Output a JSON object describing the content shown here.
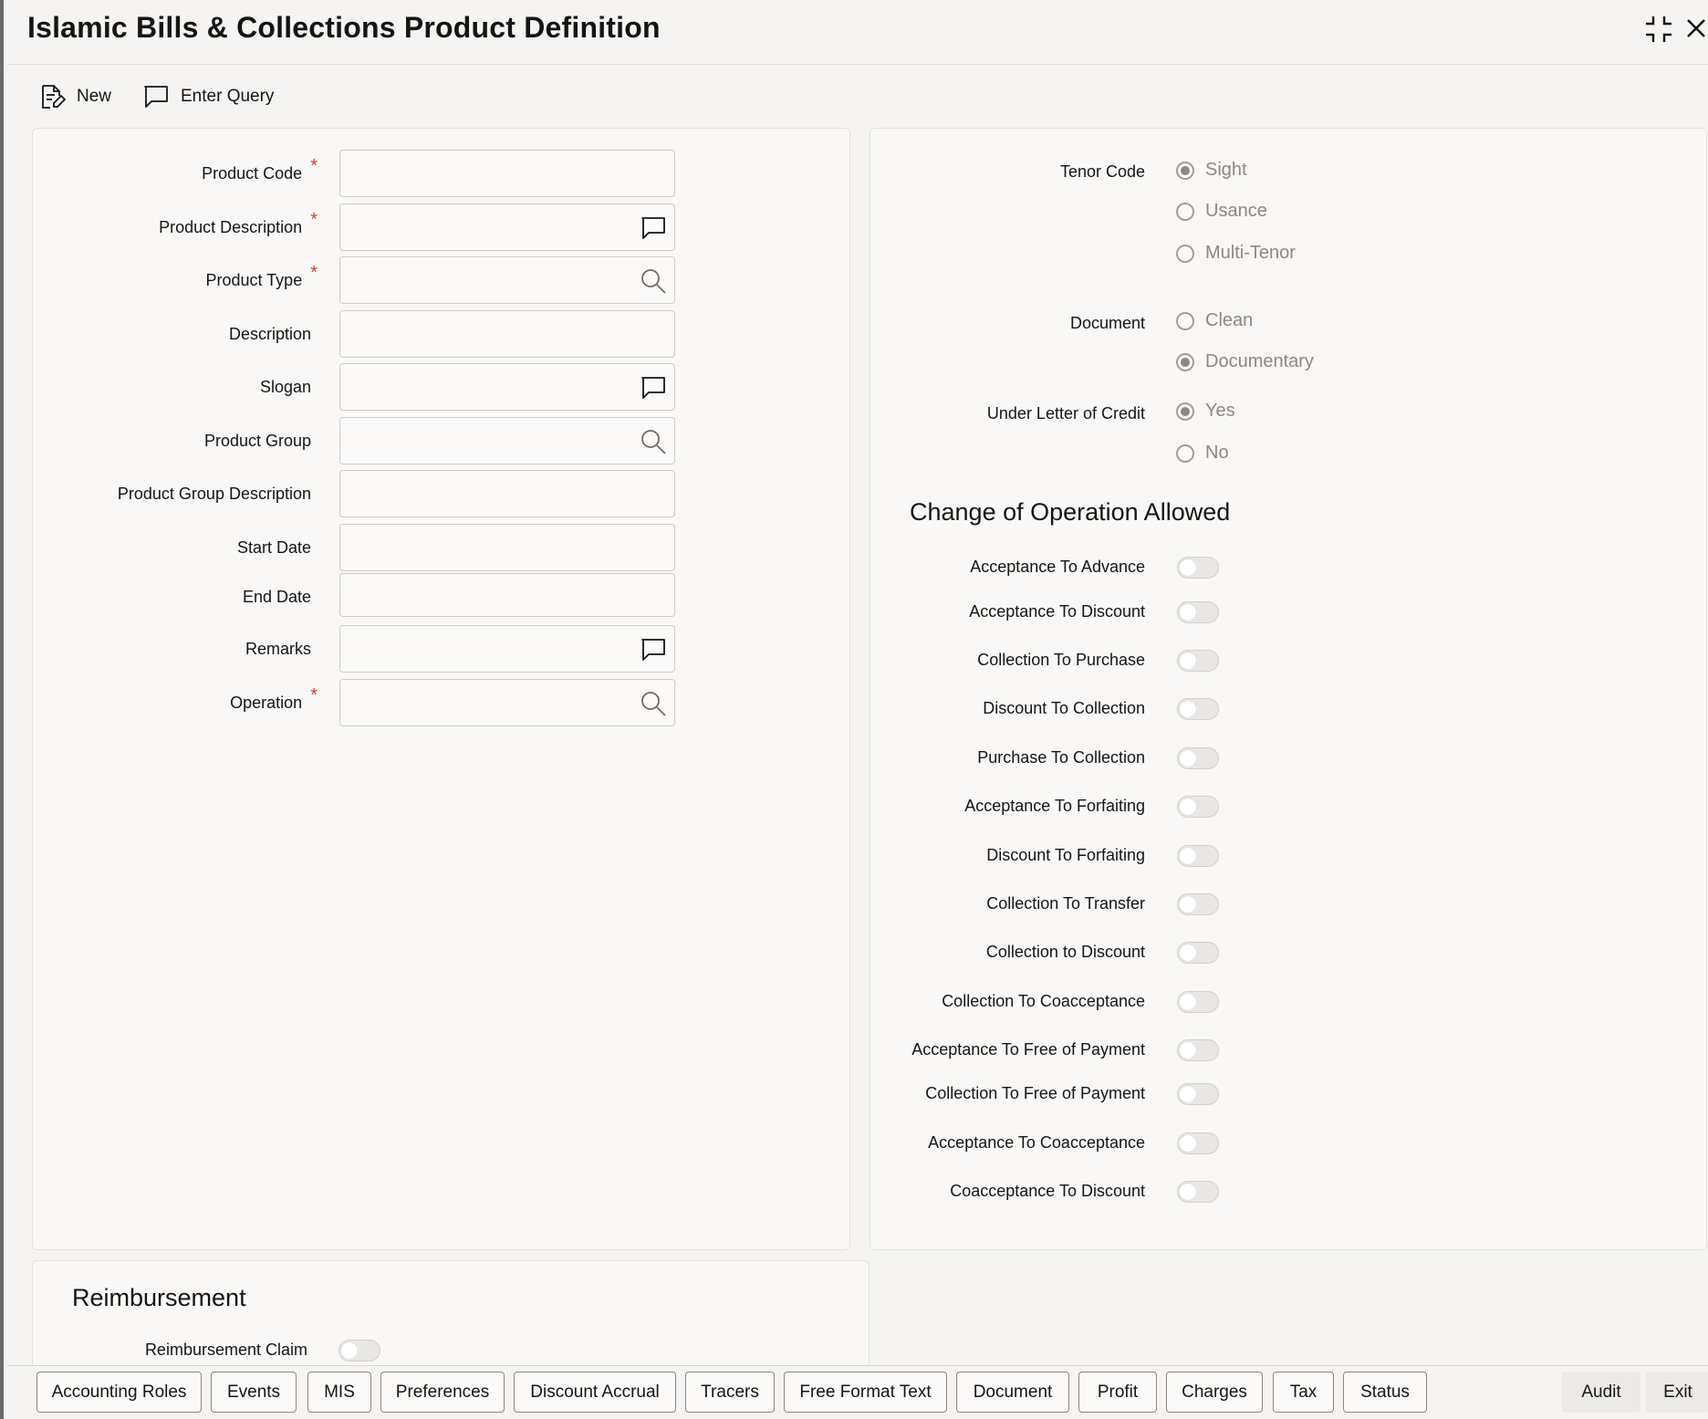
{
  "window": {
    "title": "Islamic Bills & Collections Product Definition"
  },
  "toolbar": {
    "new_label": "New",
    "enter_query_label": "Enter Query"
  },
  "form": {
    "required_mark": "*",
    "product_code": {
      "label": "Product Code",
      "value": ""
    },
    "product_description": {
      "label": "Product Description",
      "value": ""
    },
    "product_type": {
      "label": "Product Type",
      "value": ""
    },
    "description": {
      "label": "Description",
      "value": ""
    },
    "slogan": {
      "label": "Slogan",
      "value": ""
    },
    "product_group": {
      "label": "Product Group",
      "value": ""
    },
    "product_group_description": {
      "label": "Product Group Description",
      "value": ""
    },
    "start_date": {
      "label": "Start Date",
      "value": ""
    },
    "end_date": {
      "label": "End Date",
      "value": ""
    },
    "remarks": {
      "label": "Remarks",
      "value": ""
    },
    "operation": {
      "label": "Operation",
      "value": ""
    }
  },
  "tenor": {
    "label": "Tenor Code",
    "options": [
      "Sight",
      "Usance",
      "Multi-Tenor"
    ],
    "selected": "Sight"
  },
  "document": {
    "label": "Document",
    "options": [
      "Clean",
      "Documentary"
    ],
    "selected": "Documentary"
  },
  "under_lc": {
    "label": "Under Letter of Credit",
    "options": [
      "Yes",
      "No"
    ],
    "selected": "Yes"
  },
  "change_of_operation": {
    "title": "Change of Operation Allowed",
    "items": [
      {
        "label": "Acceptance To Advance",
        "on": false
      },
      {
        "label": "Acceptance To Discount",
        "on": false
      },
      {
        "label": "Collection To Purchase",
        "on": false
      },
      {
        "label": "Discount To Collection",
        "on": false
      },
      {
        "label": "Purchase To Collection",
        "on": false
      },
      {
        "label": "Acceptance To Forfaiting",
        "on": false
      },
      {
        "label": "Discount To Forfaiting",
        "on": false
      },
      {
        "label": "Collection To Transfer",
        "on": false
      },
      {
        "label": "Collection to Discount",
        "on": false
      },
      {
        "label": "Collection To Coacceptance",
        "on": false
      },
      {
        "label": "Acceptance To Free of Payment",
        "on": false
      },
      {
        "label": "Collection To Free of Payment",
        "on": false
      },
      {
        "label": "Acceptance To Coacceptance",
        "on": false
      },
      {
        "label": "Coacceptance To Discount",
        "on": false
      }
    ]
  },
  "reimbursement": {
    "title": "Reimbursement",
    "claim_label": "Reimbursement Claim",
    "claim_on": false
  },
  "footer": {
    "buttons": [
      "Accounting Roles",
      "Events",
      "MIS",
      "Preferences",
      "Discount Accrual",
      "Tracers",
      "Free Format Text",
      "Document",
      "Profit",
      "Charges",
      "Tax",
      "Status"
    ],
    "audit_label": "Audit",
    "exit_label": "Exit"
  },
  "colors": {
    "required": "#c74634",
    "text": "#161513",
    "background": "#f5f4f2"
  }
}
